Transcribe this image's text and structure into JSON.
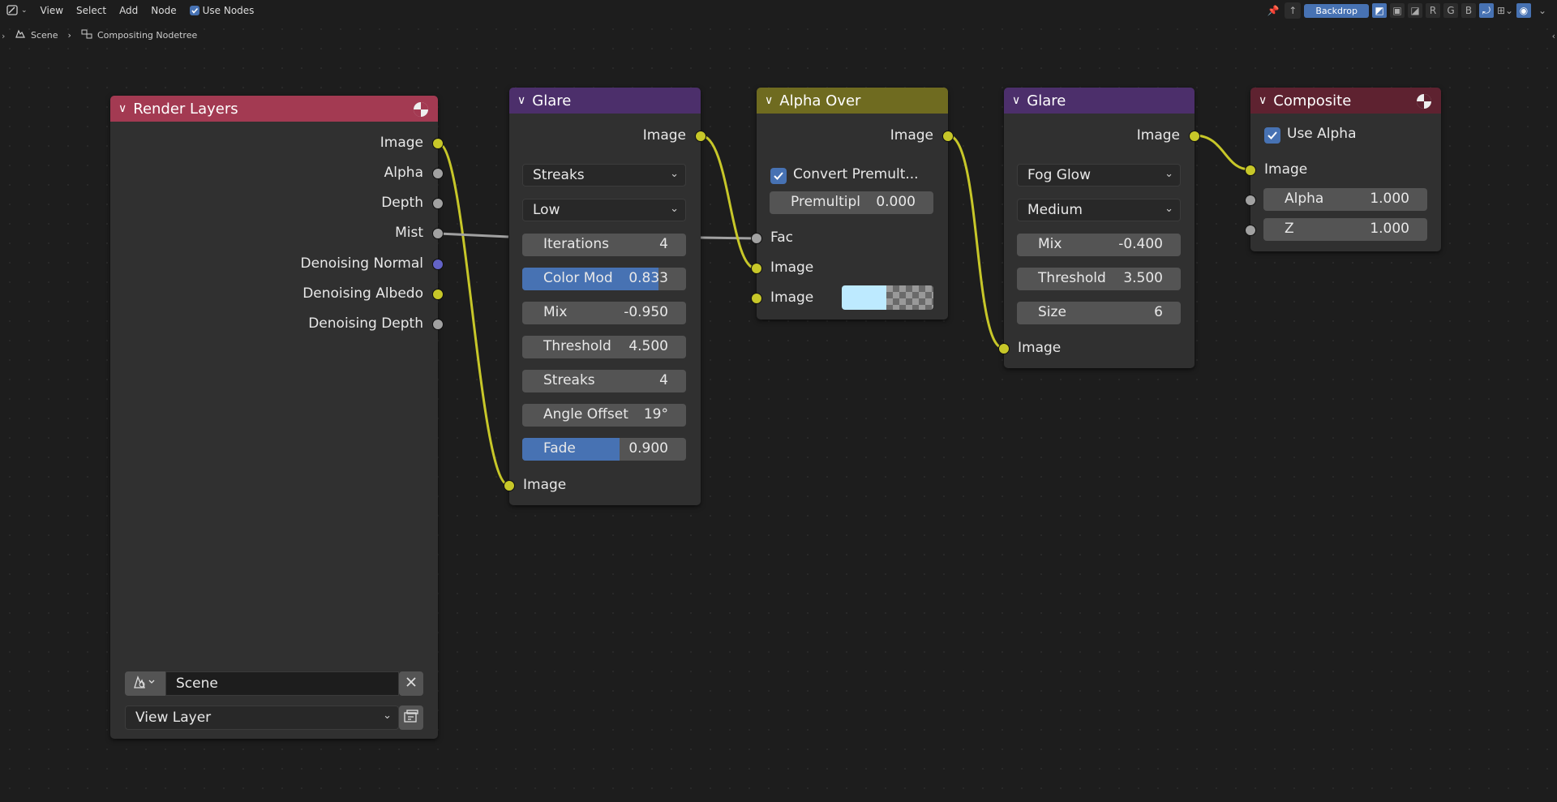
{
  "header": {
    "menu": [
      "View",
      "Select",
      "Add",
      "Node"
    ],
    "use_nodes_label": "Use Nodes",
    "backdrop_label": "Backdrop",
    "channels": [
      "R",
      "G",
      "B"
    ]
  },
  "breadcrumb": {
    "scene": "Scene",
    "tree": "Compositing Nodetree"
  },
  "nodes": {
    "render_layers": {
      "title": "Render Layers",
      "color": "#a33a52",
      "outputs": [
        "Image",
        "Alpha",
        "Depth",
        "Mist",
        "Denoising Normal",
        "Denoising Albedo",
        "Denoising Depth"
      ],
      "scene_value": "Scene",
      "view_layer_value": "View Layer"
    },
    "glare1": {
      "title": "Glare",
      "color": "#4c2f6b",
      "output": "Image",
      "type_value": "Streaks",
      "quality_value": "Low",
      "fields": [
        {
          "label": "Iterations",
          "value": "4"
        },
        {
          "label": "Color Mod",
          "value": "0.833",
          "fill": 0.833
        },
        {
          "label": "Mix",
          "value": "-0.950"
        },
        {
          "label": "Threshold",
          "value": "4.500"
        },
        {
          "label": "Streaks",
          "value": "4"
        },
        {
          "label": "Angle Offset",
          "value": "19°"
        },
        {
          "label": "Fade",
          "value": "0.900",
          "fill": 0.6
        }
      ],
      "input": "Image"
    },
    "alpha_over": {
      "title": "Alpha Over",
      "color": "#6f6b20",
      "output": "Image",
      "convert_label": "Convert Premult...",
      "premul_label": "Premultipl",
      "premul_value": "0.000",
      "inputs": [
        "Fac",
        "Image",
        "Image"
      ]
    },
    "glare2": {
      "title": "Glare",
      "color": "#4c2f6b",
      "output": "Image",
      "type_value": "Fog Glow",
      "quality_value": "Medium",
      "fields": [
        {
          "label": "Mix",
          "value": "-0.400"
        },
        {
          "label": "Threshold",
          "value": "3.500"
        },
        {
          "label": "Size",
          "value": "6"
        }
      ],
      "input": "Image"
    },
    "composite": {
      "title": "Composite",
      "color": "#5e2230",
      "output": "Image",
      "use_alpha_label": "Use Alpha",
      "input": "Image",
      "fields": [
        {
          "label": "Alpha",
          "value": "1.000"
        },
        {
          "label": "Z",
          "value": "1.000"
        }
      ]
    }
  }
}
